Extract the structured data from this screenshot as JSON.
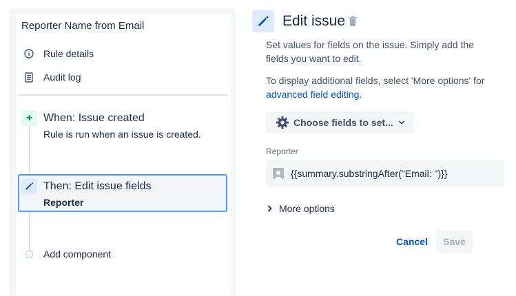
{
  "sidebar": {
    "rule_title": "Reporter Name from Email",
    "menu": [
      {
        "label": "Rule details",
        "icon": "info-icon"
      },
      {
        "label": "Audit log",
        "icon": "document-icon"
      }
    ],
    "trigger": {
      "badge": "+",
      "title": "When: Issue created",
      "subtitle": "Rule is run when an issue is created."
    },
    "action": {
      "title": "Then: Edit issue fields",
      "subtitle": "Reporter"
    },
    "add_component": "Add component"
  },
  "panel": {
    "title": "Edit issue",
    "description1": "Set values for fields on the issue. Simply add the fields you want to edit.",
    "description2_prefix": "To display additional fields, select 'More options' for ",
    "description2_link": "advanced field editing",
    "description2_suffix": ".",
    "choose_fields_label": "Choose fields to set...",
    "field_label": "Reporter",
    "field_value": "{{summary.substringAfter(\"Email: \")}}",
    "more_options_label": "More options",
    "cancel_label": "Cancel",
    "save_label": "Save"
  },
  "colors": {
    "accent": "#0052cc",
    "selection_border": "#4c9aff",
    "trigger_green": "#00875a",
    "panel_bg": "#f4f5f7"
  }
}
